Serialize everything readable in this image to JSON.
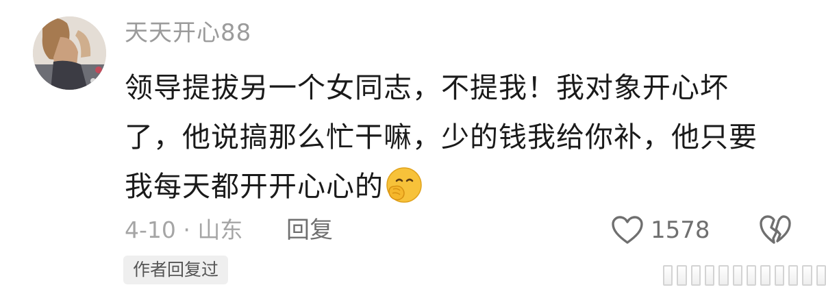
{
  "comment": {
    "username": "天天开心88",
    "text_line1": "领导提拔另一个女同志，不提我！我对象开心坏",
    "text_line2": "了，他说搞那么忙干嘛，少的钱我给你补，他只要",
    "text_line3": "我每天都开开心心的",
    "emoji_icon": "hand-over-mouth-emoji",
    "date_location": "4-10 · 山东",
    "reply_label": "回复",
    "like_count": "1578",
    "author_badge": "作者回复过"
  },
  "colors": {
    "username": "#9b9b9b",
    "body_text": "#1a1a1a",
    "meta_text": "#a5a5a5",
    "action_text": "#6f6f6f",
    "badge_bg": "#efefef",
    "emoji": "#f7c23a"
  }
}
